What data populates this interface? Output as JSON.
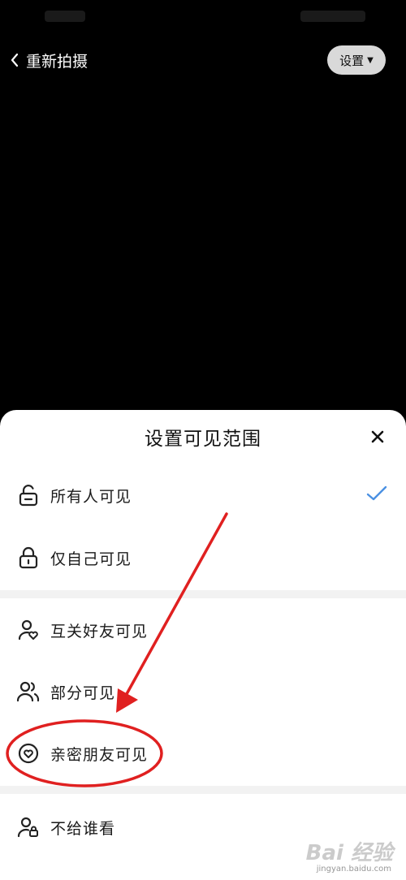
{
  "topbar": {
    "back_label": "重新拍摄",
    "settings_label": "设置"
  },
  "sheet": {
    "title": "设置可见范围",
    "options": [
      {
        "label": "所有人可见",
        "selected": true
      },
      {
        "label": "仅自己可见"
      },
      {
        "label": "互关好友可见"
      },
      {
        "label": "部分可见"
      },
      {
        "label": "亲密朋友可见",
        "highlighted": true
      },
      {
        "label": "不给谁看"
      }
    ]
  },
  "colors": {
    "accent": "#4a90e2",
    "annotation": "#e02020"
  },
  "watermark": {
    "logo": "Bai 经验",
    "url": "jingyan.baidu.com"
  }
}
